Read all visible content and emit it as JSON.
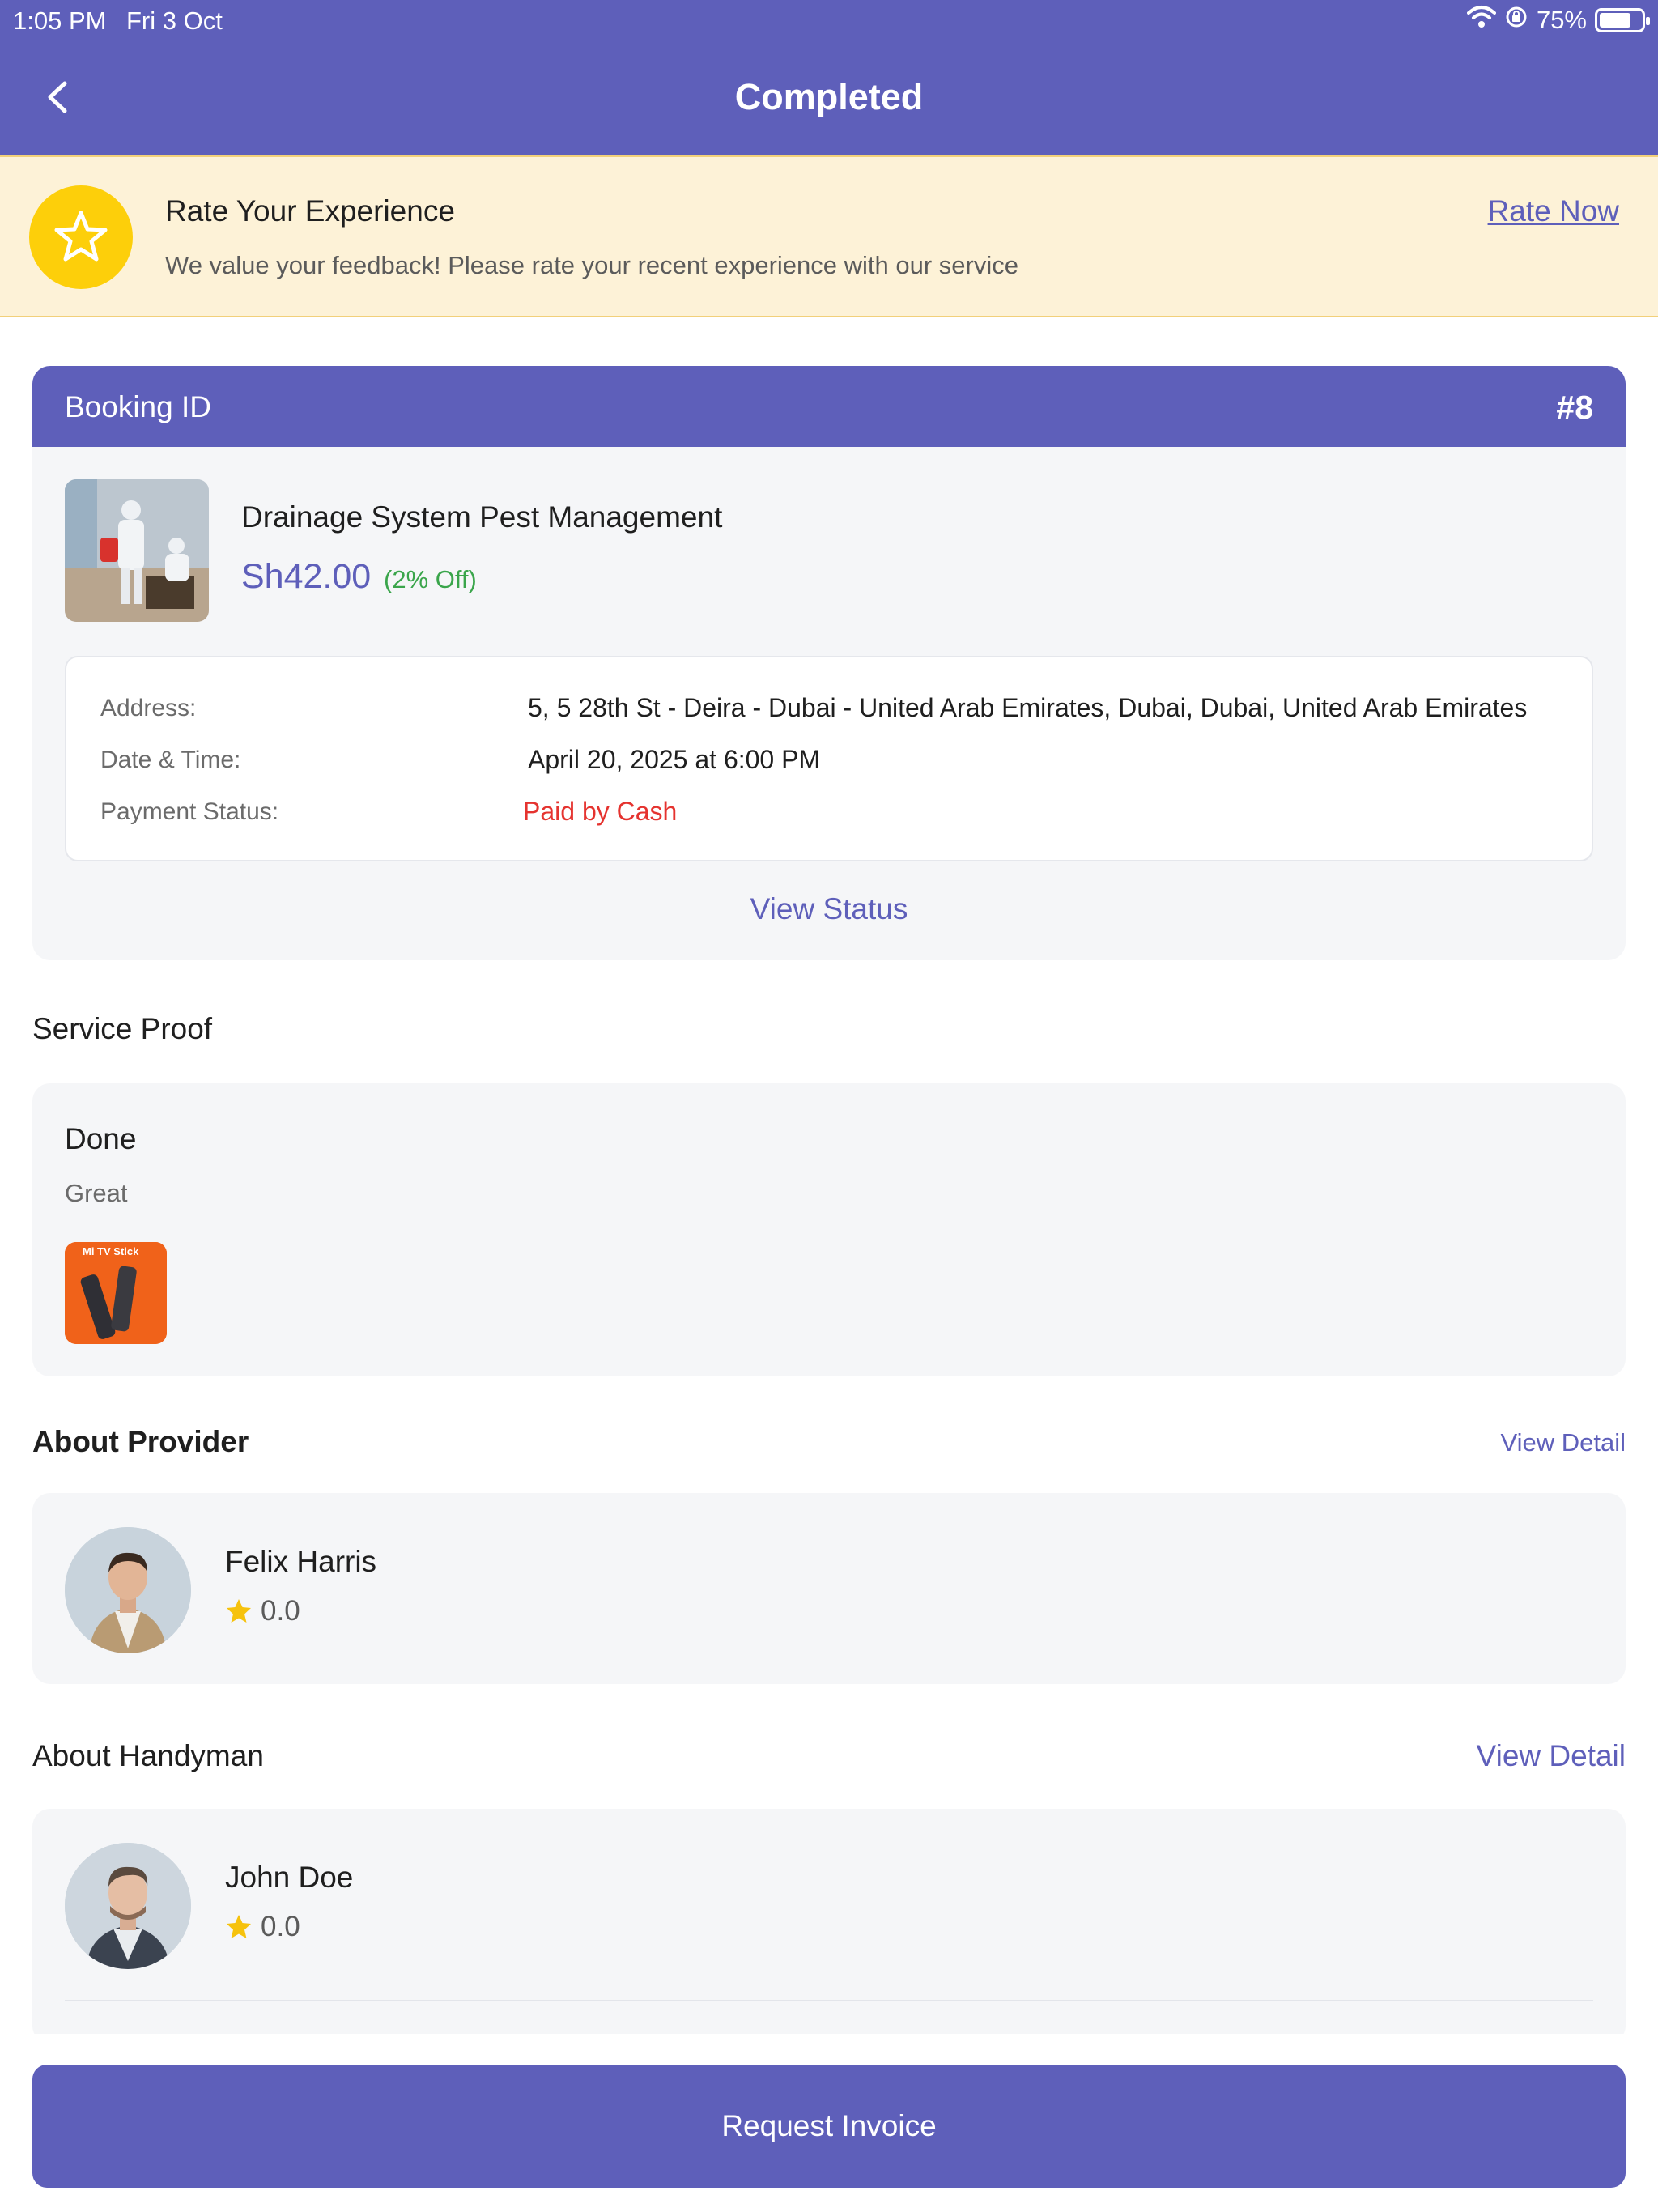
{
  "status_bar": {
    "time": "1:05 PM",
    "date": "Fri 3 Oct",
    "battery": "75%",
    "battery_level": 0.75
  },
  "header": {
    "title": "Completed"
  },
  "rate_banner": {
    "title": "Rate Your Experience",
    "subtitle": "We value your feedback! Please rate your recent experience with our service",
    "action": "Rate Now"
  },
  "booking": {
    "label": "Booking ID",
    "id": "#8",
    "service_name": "Drainage System Pest Management",
    "price": "Sh42.00",
    "discount": "(2% Off)",
    "details": [
      {
        "label": "Address:",
        "value": "5, 5 28th St - Deira - Dubai - United Arab Emirates, Dubai, Dubai, United Arab Emirates"
      },
      {
        "label": "Date & Time:",
        "value": "April 20, 2025 at 6:00 PM"
      },
      {
        "label": "Payment Status:",
        "value": "Paid by Cash"
      }
    ],
    "view_status": "View Status"
  },
  "service_proof": {
    "section_title": "Service Proof",
    "title": "Done",
    "description": "Great",
    "thumb_label": "Mi TV Stick"
  },
  "provider": {
    "section_title": "About Provider",
    "view_detail": "View Detail",
    "name": "Felix Harris",
    "rating": "0.0"
  },
  "handyman": {
    "section_title": "About Handyman",
    "view_detail": "View Detail",
    "name": "John Doe",
    "rating": "0.0"
  },
  "footer": {
    "button": "Request Invoice"
  },
  "colors": {
    "primary": "#5e5fba",
    "banner_bg": "#fdf2d7",
    "star": "#fdcf0a",
    "discount": "#3aa54b",
    "paid": "#e5332f",
    "card_bg": "#f5f6f8"
  }
}
